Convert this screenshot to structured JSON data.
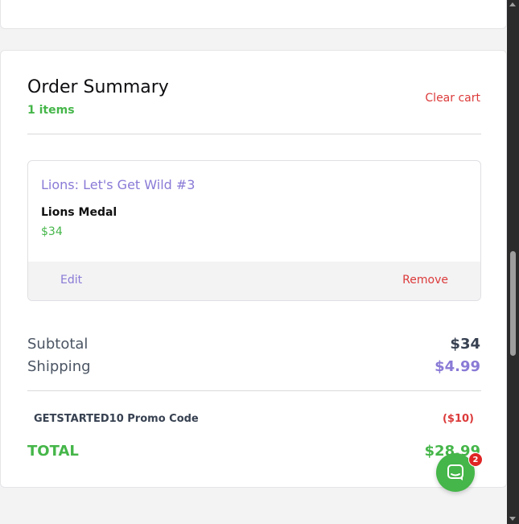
{
  "order_summary": {
    "title": "Order Summary",
    "items_count": "1 items",
    "clear_cart_label": "Clear cart"
  },
  "cart_item": {
    "title": "Lions: Let's Get Wild #3",
    "variant": "Lions Medal",
    "price": "$34",
    "edit_label": "Edit",
    "remove_label": "Remove"
  },
  "totals": {
    "subtotal_label": "Subtotal",
    "subtotal_value": "$34",
    "shipping_label": "Shipping",
    "shipping_value": "$4.99",
    "promo_label": "GETSTARTED10 Promo Code",
    "promo_value": "($10)",
    "total_label": "TOTAL",
    "total_value": "$28.99"
  },
  "chat": {
    "icon": "chat-bubble-icon",
    "badge_count": "2"
  },
  "colors": {
    "accent_green": "#45b649",
    "accent_purple": "#8a7ad6",
    "danger_red": "#dc3a3a"
  }
}
